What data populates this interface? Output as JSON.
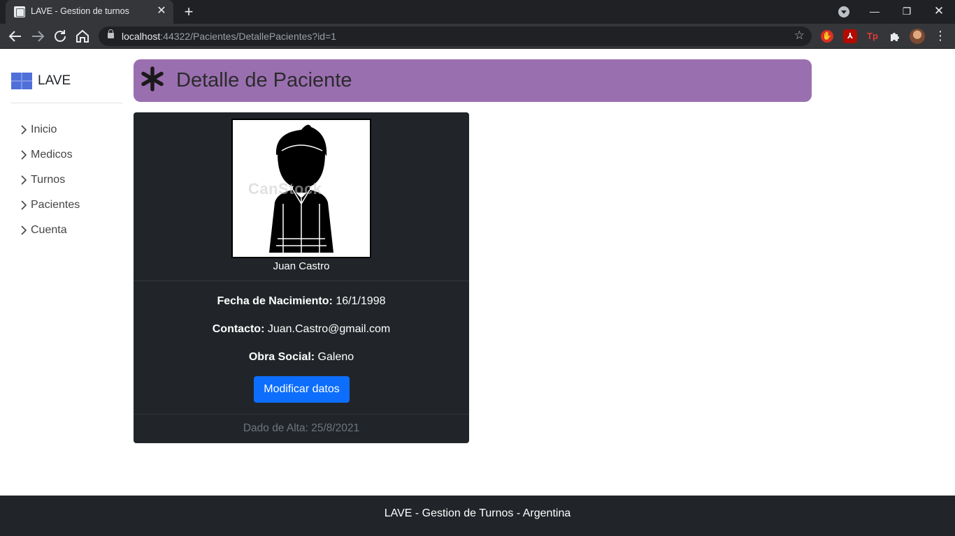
{
  "browser": {
    "tab_title": "LAVE - Gestion de turnos",
    "url_host": "localhost",
    "url_rest": ":44322/Pacientes/DetallePacientes?id=1"
  },
  "brand": {
    "name": "LAVE"
  },
  "nav": {
    "items": [
      {
        "label": "Inicio"
      },
      {
        "label": "Medicos"
      },
      {
        "label": "Turnos"
      },
      {
        "label": "Pacientes"
      },
      {
        "label": "Cuenta"
      }
    ]
  },
  "header": {
    "title": "Detalle de Paciente"
  },
  "patient": {
    "name": "Juan Castro",
    "avatar_watermark": "CanStock",
    "birth_label": "Fecha de Nacimiento:",
    "birth_value": "16/1/1998",
    "contact_label": "Contacto:",
    "contact_value": "Juan.Castro@gmail.com",
    "insurance_label": "Obra Social:",
    "insurance_value": "Galeno",
    "edit_button": "Modificar datos",
    "registered": "Dado de Alta: 25/8/2021"
  },
  "footer": {
    "text": "LAVE - Gestion de Turnos - Argentina"
  },
  "colors": {
    "header_bg": "#9a6fb0",
    "card_bg": "#212529",
    "primary": "#0d6efd",
    "footer_bg": "#212529"
  }
}
